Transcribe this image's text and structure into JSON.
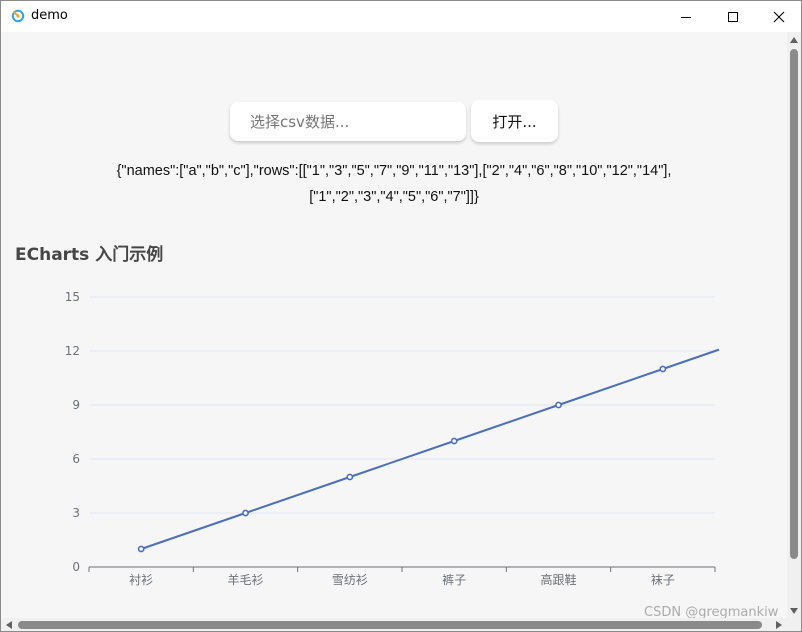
{
  "window": {
    "title": "demo"
  },
  "toolbar": {
    "csv_placeholder": "选择csv数据...",
    "open_label": "打开..."
  },
  "json_output": "{\"names\":[\"a\",\"b\",\"c\"],\"rows\":[[\"1\",\"3\",\"5\",\"7\",\"9\",\"11\",\"13\"],[\"2\",\"4\",\"6\",\"8\",\"10\",\"12\",\"14\"],[\"1\",\"2\",\"3\",\"4\",\"5\",\"6\",\"7\"]]}",
  "chart_title": "ECharts 入门示例",
  "watermark": "CSDN @gregmankiw",
  "colors": {
    "line": "#4a6fc0",
    "axis_text": "#6e7079",
    "grid": "#e0e6f1"
  },
  "chart_data": {
    "type": "line",
    "title": "ECharts 入门示例",
    "categories": [
      "衬衫",
      "羊毛衫",
      "雪纺衫",
      "裤子",
      "高跟鞋",
      "袜子"
    ],
    "series": [
      {
        "values": [
          1,
          3,
          5,
          7,
          9,
          11,
          13
        ]
      }
    ],
    "ylim": [
      0,
      15
    ],
    "yticks": [
      0,
      3,
      6,
      9,
      12,
      15
    ],
    "grid": true,
    "legend": "none"
  }
}
